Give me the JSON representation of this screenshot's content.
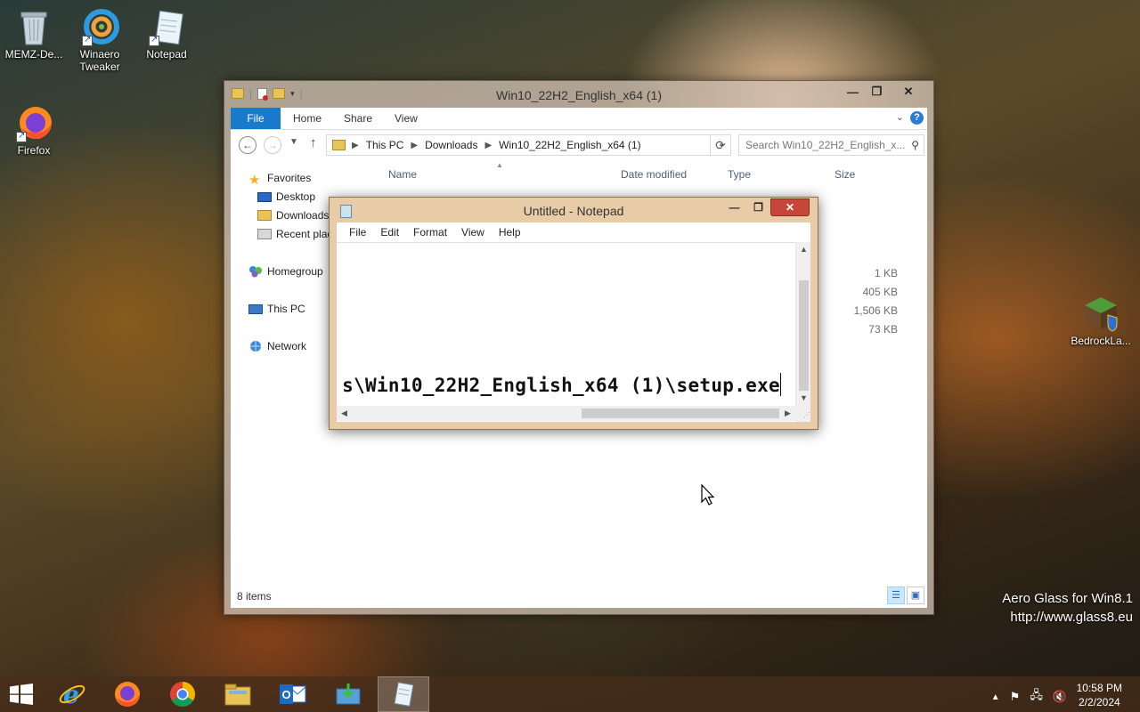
{
  "desktop": {
    "icons": [
      {
        "label": "MEMZ-De..."
      },
      {
        "label": "Winaero Tweaker"
      },
      {
        "label": "Notepad"
      },
      {
        "label": "Firefox"
      },
      {
        "label": "BedrockLa..."
      }
    ],
    "watermark": {
      "line1": "Aero Glass for Win8.1",
      "line2": "http://www.glass8.eu"
    }
  },
  "explorer": {
    "title": "Win10_22H2_English_x64 (1)",
    "ribbon_tabs": [
      "File",
      "Home",
      "Share",
      "View"
    ],
    "address": [
      "This PC",
      "Downloads",
      "Win10_22H2_English_x64 (1)"
    ],
    "search_placeholder": "Search Win10_22H2_English_x...",
    "nav": {
      "favorites": "Favorites",
      "desktop": "Desktop",
      "downloads": "Downloads",
      "recent": "Recent plac",
      "homegroup": "Homegroup",
      "this_pc": "This PC",
      "network": "Network"
    },
    "columns": [
      "Name",
      "Date modified",
      "Type",
      "Size"
    ],
    "sizes": [
      "1 KB",
      "405 KB",
      "1,506 KB",
      "73 KB"
    ],
    "status": "8 items"
  },
  "notepad": {
    "title": "Untitled - Notepad",
    "menu": [
      "File",
      "Edit",
      "Format",
      "View",
      "Help"
    ],
    "text": "s\\Win10_22H2_English_x64 (1)\\setup.exe"
  },
  "taskbar": {
    "clock_time": "10:58 PM",
    "clock_date": "2/2/2024"
  }
}
